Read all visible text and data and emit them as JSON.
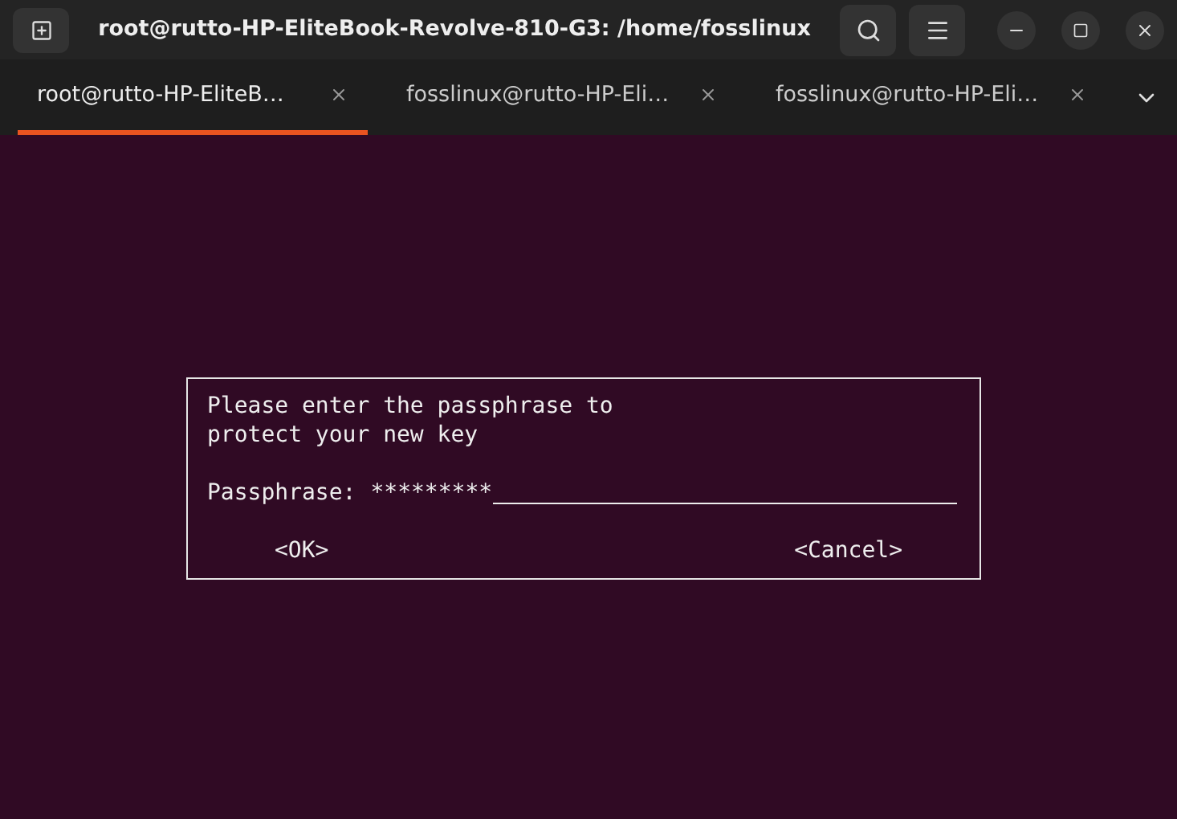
{
  "window": {
    "title": "root@rutto-HP-EliteBook-Revolve-810-G3: /home/fosslinux"
  },
  "tabs": [
    {
      "label": "root@rutto-HP-EliteB…",
      "selected": true
    },
    {
      "label": "fosslinux@rutto-HP-Eli…",
      "selected": false
    },
    {
      "label": "fosslinux@rutto-HP-Eli…",
      "selected": false
    }
  ],
  "dialog": {
    "message": [
      "Please enter the passphrase to",
      "protect your new key"
    ],
    "field_label": "Passphrase:",
    "field_value": "*********",
    "buttons": [
      "<OK>",
      "<Cancel>"
    ]
  }
}
